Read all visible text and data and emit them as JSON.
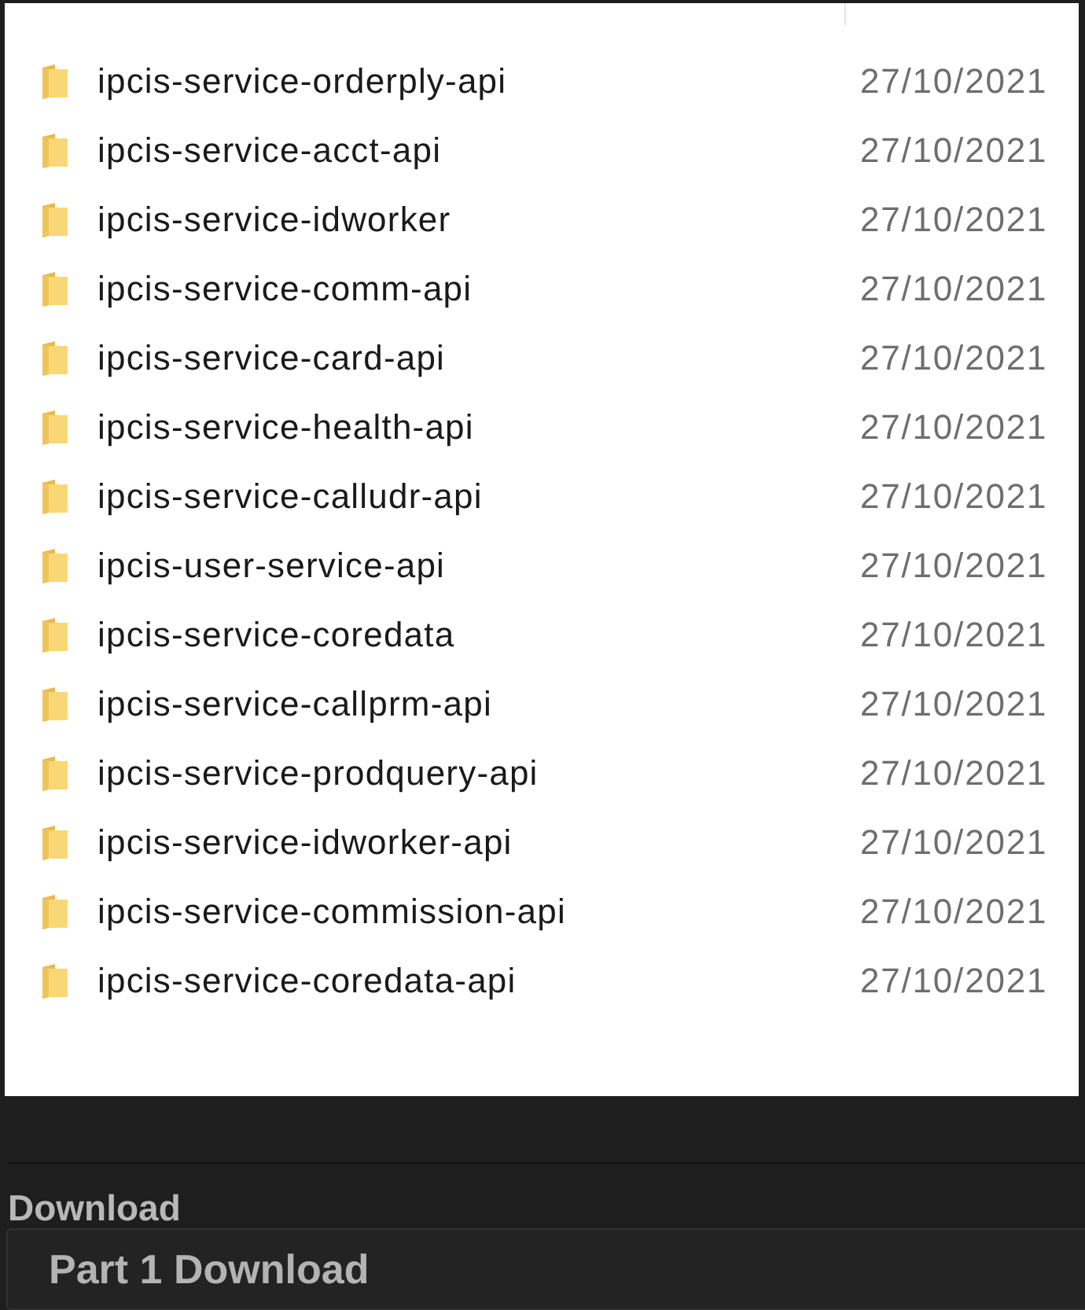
{
  "file_list": {
    "rows": [
      {
        "name": "ipcis-service-orderply-api",
        "date": "27/10/2021"
      },
      {
        "name": "ipcis-service-acct-api",
        "date": "27/10/2021"
      },
      {
        "name": "ipcis-service-idworker",
        "date": "27/10/2021"
      },
      {
        "name": "ipcis-service-comm-api",
        "date": "27/10/2021"
      },
      {
        "name": "ipcis-service-card-api",
        "date": "27/10/2021"
      },
      {
        "name": "ipcis-service-health-api",
        "date": "27/10/2021"
      },
      {
        "name": "ipcis-service-calludr-api",
        "date": "27/10/2021"
      },
      {
        "name": "ipcis-user-service-api",
        "date": "27/10/2021"
      },
      {
        "name": "ipcis-service-coredata",
        "date": "27/10/2021"
      },
      {
        "name": "ipcis-service-callprm-api",
        "date": "27/10/2021"
      },
      {
        "name": "ipcis-service-prodquery-api",
        "date": "27/10/2021"
      },
      {
        "name": "ipcis-service-idworker-api",
        "date": "27/10/2021"
      },
      {
        "name": "ipcis-service-commission-api",
        "date": "27/10/2021"
      },
      {
        "name": "ipcis-service-coredata-api",
        "date": "27/10/2021"
      }
    ]
  },
  "download_section": {
    "heading": "Download",
    "buttons": [
      "Part 1 Download"
    ]
  }
}
